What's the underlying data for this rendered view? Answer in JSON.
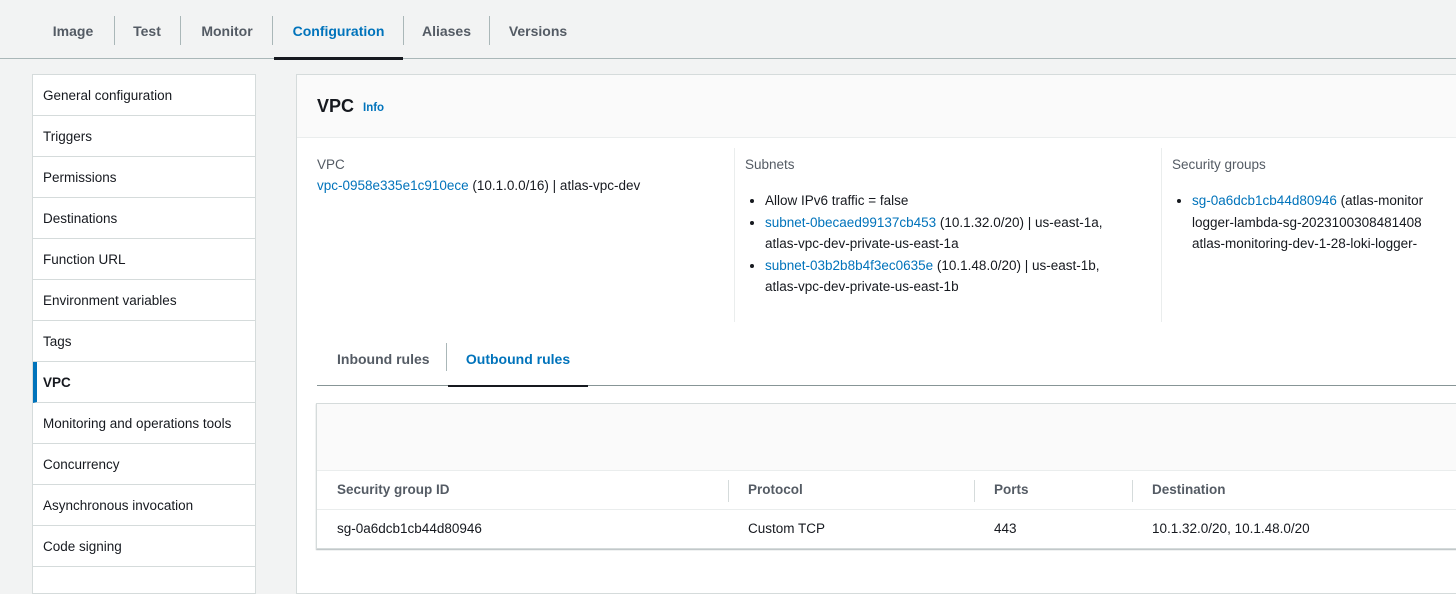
{
  "top_tabs": [
    {
      "label": "Image"
    },
    {
      "label": "Test"
    },
    {
      "label": "Monitor"
    },
    {
      "label": "Configuration"
    },
    {
      "label": "Aliases"
    },
    {
      "label": "Versions"
    }
  ],
  "sidebar": {
    "active": "VPC",
    "items": [
      {
        "label": "General configuration"
      },
      {
        "label": "Triggers"
      },
      {
        "label": "Permissions"
      },
      {
        "label": "Destinations"
      },
      {
        "label": "Function URL"
      },
      {
        "label": "Environment variables"
      },
      {
        "label": "Tags"
      },
      {
        "label": "VPC"
      },
      {
        "label": "Monitoring and operations tools"
      },
      {
        "label": "Concurrency"
      },
      {
        "label": "Asynchronous invocation"
      },
      {
        "label": "Code signing"
      }
    ]
  },
  "panel": {
    "title": "VPC",
    "info": "Info",
    "vpc": {
      "label": "VPC",
      "id_link": "vpc-0958e335e1c910ece",
      "detail": " (10.1.0.0/16) | atlas-vpc-dev"
    },
    "subnets": {
      "label": "Subnets",
      "ipv6": "Allow IPv6 traffic = false",
      "items": [
        {
          "link": "subnet-0becaed99137cb453",
          "detail_1": " (10.1.32.0/20) | us-east-1a,",
          "detail_2": "atlas-vpc-dev-private-us-east-1a"
        },
        {
          "link": "subnet-03b2b8b4f3ec0635e",
          "detail_1": " (10.1.48.0/20) | us-east-1b,",
          "detail_2": "atlas-vpc-dev-private-us-east-1b"
        }
      ]
    },
    "security_groups": {
      "label": "Security groups",
      "items": [
        {
          "link": "sg-0a6dcb1cb44d80946",
          "detail_1": " (atlas-monitor",
          "detail_2": "logger-lambda-sg-202310030848140​8",
          "detail_3": "atlas-monitoring-dev-1-28-loki-logger-"
        }
      ]
    },
    "rule_tabs": {
      "inbound": "Inbound rules",
      "outbound": "Outbound rules",
      "active": "outbound"
    },
    "table": {
      "columns": [
        "Security group ID",
        "Protocol",
        "Ports",
        "Destination"
      ],
      "rows": [
        [
          "sg-0a6dcb1cb44d80946",
          "Custom TCP",
          "443",
          "10.1.32.0/20, 10.1.48.0/20"
        ]
      ]
    }
  }
}
